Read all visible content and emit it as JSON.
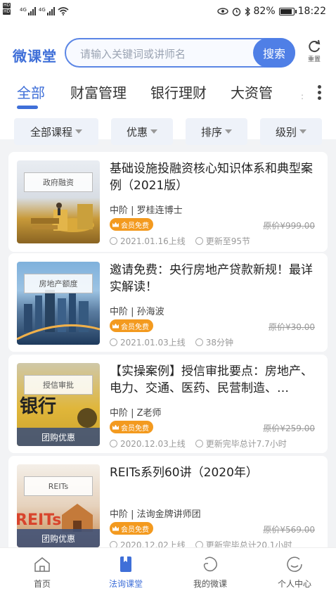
{
  "status_bar": {
    "network": "4G",
    "battery": "82%",
    "time": "18:22"
  },
  "header": {
    "brand": "微课堂",
    "search_placeholder": "请输入关键词或讲师名",
    "search_button": "搜索",
    "reset_label": "重置"
  },
  "tabs": [
    "全部",
    "财富管理",
    "银行理财",
    "大资管"
  ],
  "filters": [
    "全部课程",
    "优惠",
    "排序",
    "级别"
  ],
  "courses": [
    {
      "tag": "政府融资",
      "title": "基础设施投融资核心知识体系和典型案例（2021版）",
      "meta": "中阶 | 罗桂连博士",
      "badge": "会员免费",
      "original_price": "原价¥999.00",
      "date": "2021.01.16上线",
      "update": "更新至95节",
      "group": ""
    },
    {
      "tag": "房地产额度",
      "title": "邀请免费：央行房地产贷款新规！最详实解读！",
      "meta": "中阶 | 孙海波",
      "badge": "会员免费",
      "original_price": "原价¥30.00",
      "date": "2021.01.03上线",
      "update": "38分钟",
      "group": ""
    },
    {
      "tag": "授信审批",
      "title": "【实操案例】授信审批要点：房地产、电力、交通、医药、民营制造、…",
      "meta": "中阶 | Z老师",
      "badge": "会员免费",
      "original_price": "原价¥259.00",
      "date": "2020.12.03上线",
      "update": "更新完毕总计7.7小时",
      "group": "团购优惠"
    },
    {
      "tag": "REITs",
      "title": "REITs系列60讲（2020年）",
      "meta": "中阶 | 法询金牌讲师团",
      "badge": "会员免费",
      "original_price": "原价¥569.00",
      "date": "2020.12.02上线",
      "update": "更新完毕总计20.1小时",
      "group": "团购优惠"
    }
  ],
  "bottom_nav": [
    "首页",
    "法询课堂",
    "我的微课",
    "个人中心"
  ],
  "colors": {
    "accent": "#3f6fd8",
    "vip": "#f39a1f"
  }
}
